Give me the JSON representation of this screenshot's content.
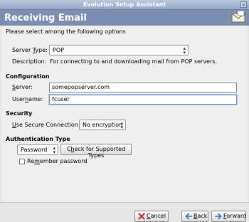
{
  "window": {
    "title": "Evolution Setup Assistant",
    "close_glyph": "×"
  },
  "header": {
    "title": "Receiving Email",
    "icon": "mail-icon"
  },
  "intro": "Please select among the following options",
  "server_type": {
    "label": "Server Type:",
    "mnemonic": "T",
    "value": "POP",
    "description_label": "Description:",
    "description": "For connecting to and downloading mail from POP servers."
  },
  "configuration": {
    "heading": "Configuration",
    "server_label": "Server:",
    "server_value": "somepopserver.com",
    "username_label": "Username:",
    "username_value": "fcuser"
  },
  "security": {
    "heading": "Security",
    "label": "Use Secure Connection:",
    "value": "No encryption"
  },
  "auth": {
    "heading": "Authentication Type",
    "method": "Password",
    "check_button": "Check for Supported Types",
    "remember_label": "Remember password",
    "remember_checked": false
  },
  "buttons": {
    "cancel": "Cancel",
    "back": "Back",
    "forward": "Forward"
  },
  "colors": {
    "header_bg": "#7d8fb0",
    "page_bg": "#efefef",
    "frame_bg": "#e6e6e6",
    "cancel_icon": "#d0312d",
    "nav_icon": "#3b7bd9"
  }
}
